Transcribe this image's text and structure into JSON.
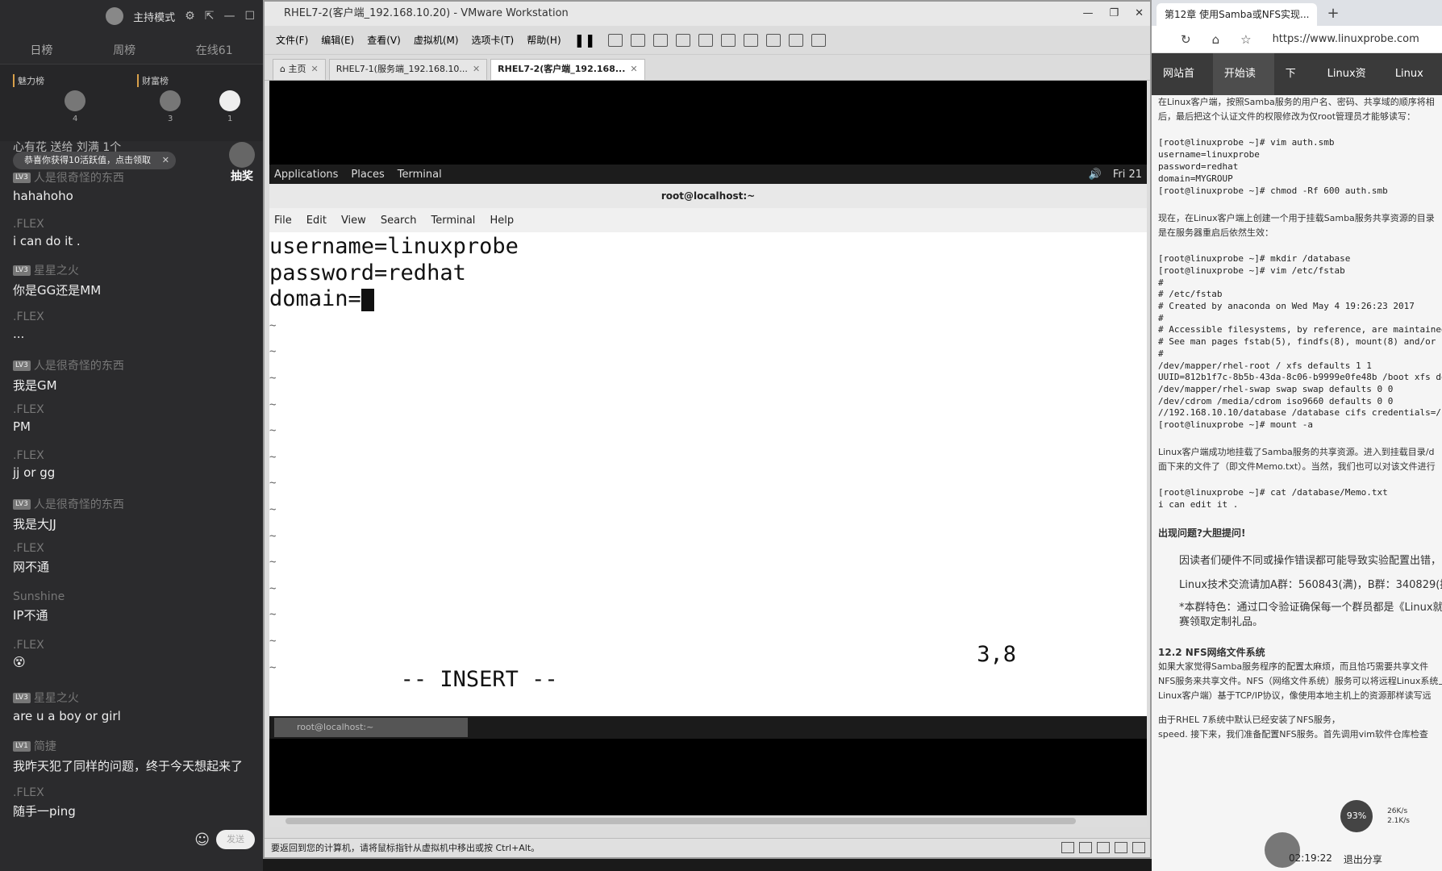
{
  "left_panel": {
    "mode": "主持模式",
    "tabs": [
      "日榜",
      "周榜",
      "在线61"
    ],
    "rank": {
      "charm": "魅力榜",
      "wealth": "财富榜",
      "counts": [
        "4",
        "3",
        "1"
      ]
    },
    "notice": "恭喜你获得10活跃值，点击领取",
    "top_line": "心有花 送给 刘满 1个",
    "gift_label": "抽奖",
    "messages": [
      {
        "user": "人是很奇怪的东西",
        "level": "LV3",
        "text": "hahahoho"
      },
      {
        "user": ".FLEX",
        "level": "",
        "text": "i can do it ."
      },
      {
        "user": "星星之火",
        "level": "LV3",
        "text": "你是GG还是MM"
      },
      {
        "user": ".FLEX",
        "level": "",
        "text": "..."
      },
      {
        "user": "人是很奇怪的东西",
        "level": "LV3",
        "text": "我是GM"
      },
      {
        "user": ".FLEX",
        "level": "",
        "text": "PM"
      },
      {
        "user": ".FLEX",
        "level": "",
        "text": "jj or gg"
      },
      {
        "user": "人是很奇怪的东西",
        "level": "LV3",
        "text": "我是大JJ"
      },
      {
        "user": ".FLEX",
        "level": "",
        "text": "网不通"
      },
      {
        "user": "Sunshine",
        "level": "",
        "text": "IP不通"
      },
      {
        "user": ".FLEX",
        "level": "",
        "text": "😵"
      },
      {
        "user": "星星之火",
        "level": "LV3",
        "text": "are u a boy or girl"
      },
      {
        "user": "简捷",
        "level": "LV1",
        "text": "我昨天犯了同样的问题，终于今天想起来了"
      },
      {
        "user": ".FLEX",
        "level": "",
        "text": "随手一ping"
      }
    ],
    "send": "发送"
  },
  "vmware": {
    "title": "RHEL7-2(客户端_192.168.10.20) - VMware Workstation",
    "menu": [
      "文件(F)",
      "编辑(E)",
      "查看(V)",
      "虚拟机(M)",
      "选项卡(T)",
      "帮助(H)"
    ],
    "tabs": [
      {
        "label": "主页"
      },
      {
        "label": "RHEL7-1(服务端_192.168.10..."
      },
      {
        "label": "RHEL7-2(客户端_192.168..."
      }
    ],
    "gnome": {
      "apps": "Applications",
      "places": "Places",
      "terminal": "Terminal",
      "time": "Fri 21"
    },
    "terminal": {
      "title": "root@localhost:~",
      "menu": [
        "File",
        "Edit",
        "View",
        "Search",
        "Terminal",
        "Help"
      ],
      "lines": [
        "username=linuxprobe",
        "password=redhat",
        "domain="
      ],
      "tilde": "~",
      "mode": "-- INSERT --",
      "position": "3,8"
    },
    "taskbar_item": "root@localhost:~",
    "statusbar": "要返回到您的计算机，请将鼠标指针从虚拟机中移出或按 Ctrl+Alt。"
  },
  "browser": {
    "tab": "第12章 使用Samba或NFS实现...",
    "url": "https://www.linuxprobe.com",
    "nav": [
      "网站首页",
      "开始读书",
      "下载",
      "Linux资讯",
      "Linux书"
    ],
    "lines": [
      "在Linux客户端，按照Samba服务的用户名、密码、共享域的顺序将相",
      "后，最后把这个认证文件的权限修改为仅root管理员才能够读写：",
      "[root@linuxprobe ~]# vim auth.smb",
      "username=linuxprobe",
      "password=redhat",
      "domain=MYGROUP",
      "[root@linuxprobe ~]# chmod -Rf 600 auth.smb",
      "现在，在Linux客户端上创建一个用于挂载Samba服务共享资源的目录",
      "是在服务器重启后依然生效：",
      "[root@linuxprobe ~]# mkdir /database",
      "[root@linuxprobe ~]# vim /etc/fstab",
      "#",
      "# /etc/fstab",
      "# Created by anaconda on Wed May 4 19:26:23 2017",
      "#",
      "# Accessible filesystems, by reference, are maintained",
      "# See man pages fstab(5), findfs(8), mount(8) and/or b",
      "#",
      "/dev/mapper/rhel-root / xfs defaults 1 1",
      "UUID=812b1f7c-8b5b-43da-8c06-b9999e0fe48b /boot xfs de",
      "/dev/mapper/rhel-swap swap swap defaults 0 0",
      "/dev/cdrom /media/cdrom iso9660 defaults 0 0",
      "//192.168.10.10/database /database cifs credentials=/",
      "[root@linuxprobe ~]# mount -a",
      "Linux客户端成功地挂载了Samba服务的共享资源。进入到挂载目录/d",
      "面下来的文件了（即文件Memo.txt）。当然，我们也可以对该文件进行",
      "[root@linuxprobe ~]# cat /database/Memo.txt",
      "i can edit it .",
      "出现问题?大胆提问!",
      "因读者们硬件不同或操作错误都可能导致实验配置出错，",
      "Linux技术交流请加A群：560843(满)，B群：340829(推",
      "*本群特色：通过口令验证确保每一个群员都是《Linux就",
      "赛领取定制礼品。",
      "12.2 NFS网络文件系统",
      "如果大家觉得Samba服务程序的配置太麻烦，而且恰巧需要共享文件",
      "NFS服务来共享文件。NFS（网络文件系统）服务可以将远程Linux系统上",
      "Linux客户端）基于TCP/IP协议，像使用本地主机上的资源那样读写远",
      "由于RHEL 7系统中默认已经安装了NFS服务，",
      "speed. 接下来，我们准备配置NFS服务。首先调用vim软件仓库检查"
    ],
    "overlay": {
      "pct": "93%",
      "up": "26K/s",
      "down": "2.1K/s",
      "time": "02:19:22",
      "exit": "退出分享"
    }
  }
}
